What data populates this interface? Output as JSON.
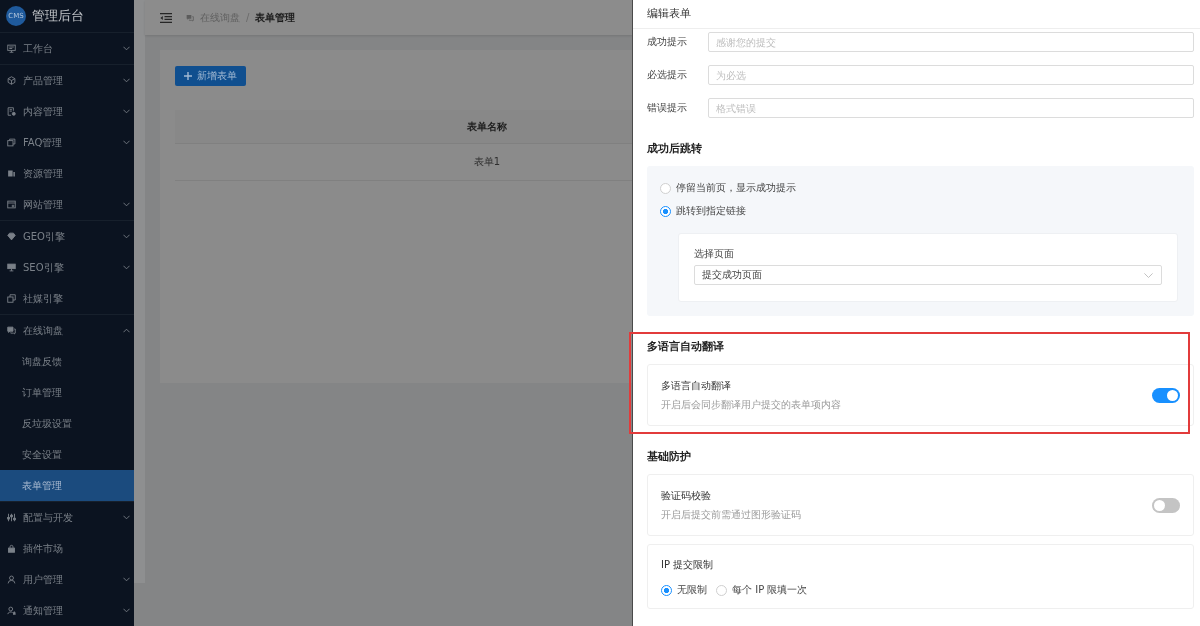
{
  "sidebar": {
    "logo": {
      "badge": "CMS",
      "title": "管理后台"
    },
    "groups": [
      [
        {
          "label": "工作台",
          "kind": "submenu",
          "expanded": false,
          "selected": false
        }
      ],
      [
        {
          "label": "产品管理",
          "kind": "submenu",
          "expanded": false,
          "selected": false
        },
        {
          "label": "内容管理",
          "kind": "submenu",
          "expanded": false,
          "selected": false
        },
        {
          "label": "FAQ管理",
          "kind": "submenu",
          "expanded": false,
          "selected": false
        },
        {
          "label": "资源管理",
          "kind": "link",
          "selected": false
        },
        {
          "label": "网站管理",
          "kind": "submenu",
          "expanded": false,
          "selected": false
        }
      ],
      [
        {
          "label": "GEO引擎",
          "kind": "submenu",
          "expanded": false,
          "selected": false
        },
        {
          "label": "SEO引擎",
          "kind": "submenu",
          "expanded": false,
          "selected": false
        },
        {
          "label": "社媒引擎",
          "kind": "link",
          "selected": false
        }
      ],
      [
        {
          "label": "在线询盘",
          "kind": "submenu",
          "expanded": true,
          "selected": false,
          "children": [
            {
              "label": "询盘反馈",
              "selected": false
            },
            {
              "label": "订单管理",
              "selected": false
            },
            {
              "label": "反垃圾设置",
              "selected": false
            },
            {
              "label": "安全设置",
              "selected": false
            },
            {
              "label": "表单管理",
              "selected": true
            }
          ]
        }
      ],
      [
        {
          "label": "配置与开发",
          "kind": "submenu",
          "expanded": false,
          "selected": false
        },
        {
          "label": "插件市场",
          "kind": "link",
          "selected": false
        },
        {
          "label": "用户管理",
          "kind": "submenu",
          "expanded": false,
          "selected": false
        },
        {
          "label": "通知管理",
          "kind": "submenu",
          "expanded": false,
          "selected": false
        }
      ]
    ]
  },
  "header": {
    "breadcrumb": [
      {
        "label": "在线询盘"
      },
      {
        "label": "表单管理"
      }
    ],
    "separator": "/"
  },
  "page": {
    "add_button": "新增表单",
    "table": {
      "columns": [
        "表单名称"
      ],
      "rows": [
        [
          "表单1"
        ]
      ]
    }
  },
  "drawer": {
    "title": "编辑表单",
    "fields": [
      {
        "label": "成功提示",
        "placeholder": "感谢您的提交"
      },
      {
        "label": "必选提示",
        "placeholder": "为必选"
      },
      {
        "label": "错误提示",
        "placeholder": "格式错误"
      }
    ],
    "sections": [
      {
        "kind": "redirect",
        "title": "成功后跳转",
        "highlighted": false,
        "options": [
          {
            "label": "停留当前页，显示成功提示",
            "selected": false
          },
          {
            "label": "跳转到指定链接",
            "selected": true
          }
        ],
        "select": {
          "label": "选择页面",
          "value": "提交成功页面"
        }
      },
      {
        "kind": "settings",
        "title": "多语言自动翻译",
        "highlighted": true,
        "settings": [
          {
            "kind": "switch",
            "title": "多语言自动翻译",
            "description": "开启后会同步翻译用户提交的表单项内容",
            "on": true
          }
        ]
      },
      {
        "kind": "settings",
        "title": "基础防护",
        "highlighted": false,
        "settings": [
          {
            "kind": "switch",
            "title": "验证码校验",
            "description": "开启后提交前需通过图形验证码",
            "on": false
          },
          {
            "kind": "radio",
            "title": "IP 提交限制",
            "options": [
              {
                "label": "无限制",
                "selected": true
              },
              {
                "label": "每个 IP 限填一次",
                "selected": false
              }
            ]
          }
        ]
      }
    ]
  }
}
